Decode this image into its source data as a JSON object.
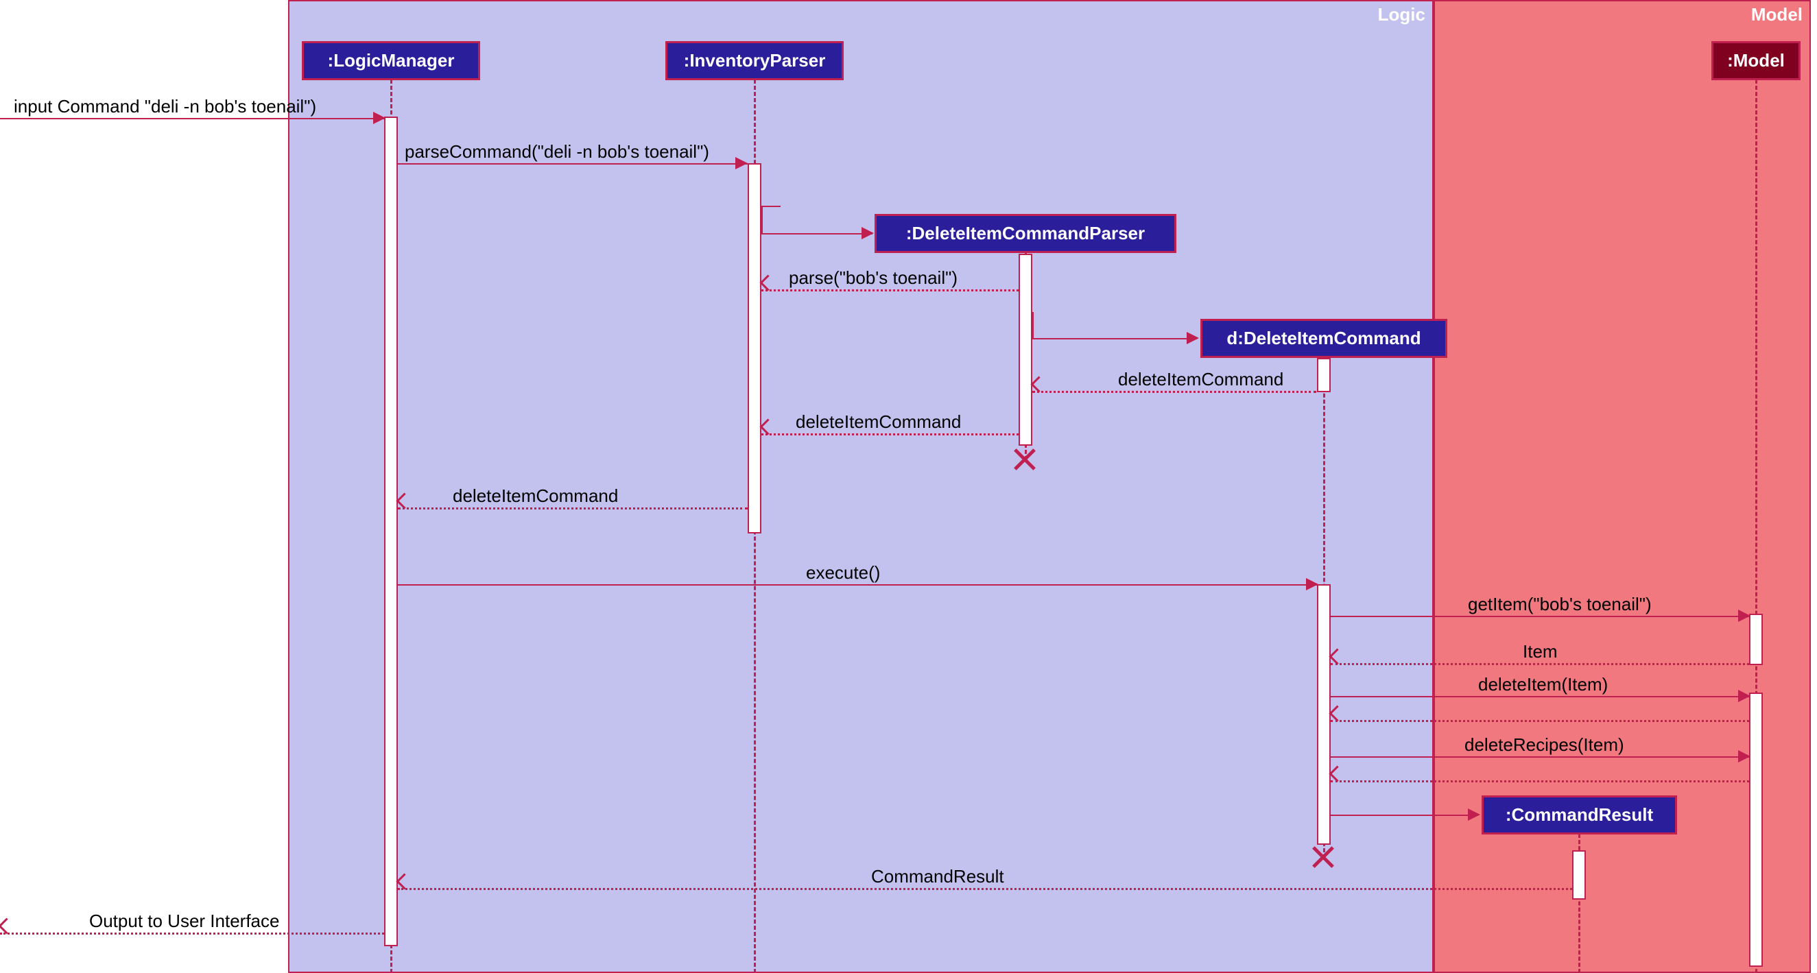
{
  "frames": {
    "logic_label": "Logic",
    "model_label": "Model"
  },
  "participants": {
    "logic_manager": ":LogicManager",
    "inventory_parser": ":InventoryParser",
    "delete_item_cmd_parser": ":DeleteItemCommandParser",
    "delete_item_cmd": "d:DeleteItemCommand",
    "model": ":Model",
    "command_result": ":CommandResult"
  },
  "messages": {
    "input": "input Command \"deli -n bob's toenail\")",
    "parse_command": "parseCommand(\"deli -n bob's toenail\")",
    "parse": "parse(\"bob's toenail\")",
    "delete_item_command_1": "deleteItemCommand",
    "delete_item_command_2": "deleteItemCommand",
    "delete_item_command_3": "deleteItemCommand",
    "execute": "execute()",
    "get_item": "getItem(\"bob's toenail\")",
    "item": "Item",
    "delete_item": "deleteItem(Item)",
    "delete_recipes": "deleteRecipes(Item)",
    "command_result": "CommandResult",
    "output": "Output to User Interface"
  }
}
